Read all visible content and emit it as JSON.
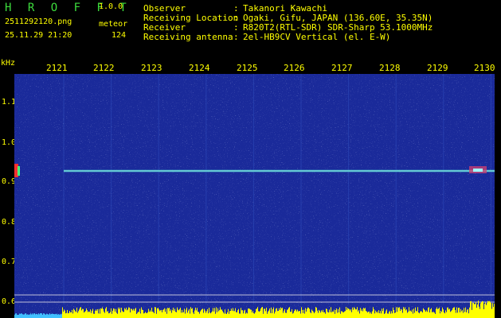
{
  "app": {
    "logo": "H R O F F T",
    "version": "1.0.0"
  },
  "file": {
    "name": "2511292120.png",
    "datetime": "25.11.29 21:20"
  },
  "meteor": {
    "label": "meteor",
    "count": "124"
  },
  "station": {
    "rows": [
      {
        "label": "Observer",
        "value": "Takanori Kawachi"
      },
      {
        "label": "Receiving Location",
        "value": "Ogaki, Gifu, JAPAN (136.60E, 35.35N)"
      },
      {
        "label": "Receiver",
        "value": "R820T2(RTL-SDR) SDR-Sharp 53.1000MHz"
      },
      {
        "label": "Receiving antenna",
        "value": "2el-HB9CV Vertical (el. E-W)"
      }
    ]
  },
  "spectrogram": {
    "unit": "kHz",
    "x_ticks": [
      "2121",
      "2122",
      "2123",
      "2124",
      "2125",
      "2126",
      "2127",
      "2128",
      "2129",
      "2130"
    ],
    "y_ticks": [
      "1.1",
      "1.0",
      "0.9",
      "0.8",
      "0.7",
      "0.6"
    ],
    "colors": {
      "background": "#1a2a9a",
      "text": "#ffff00",
      "logo": "#3ddc3d",
      "carrier": "#7fe0e0",
      "signal_bar": "#ffff00",
      "meteor_echo": "#ff3030"
    }
  }
}
